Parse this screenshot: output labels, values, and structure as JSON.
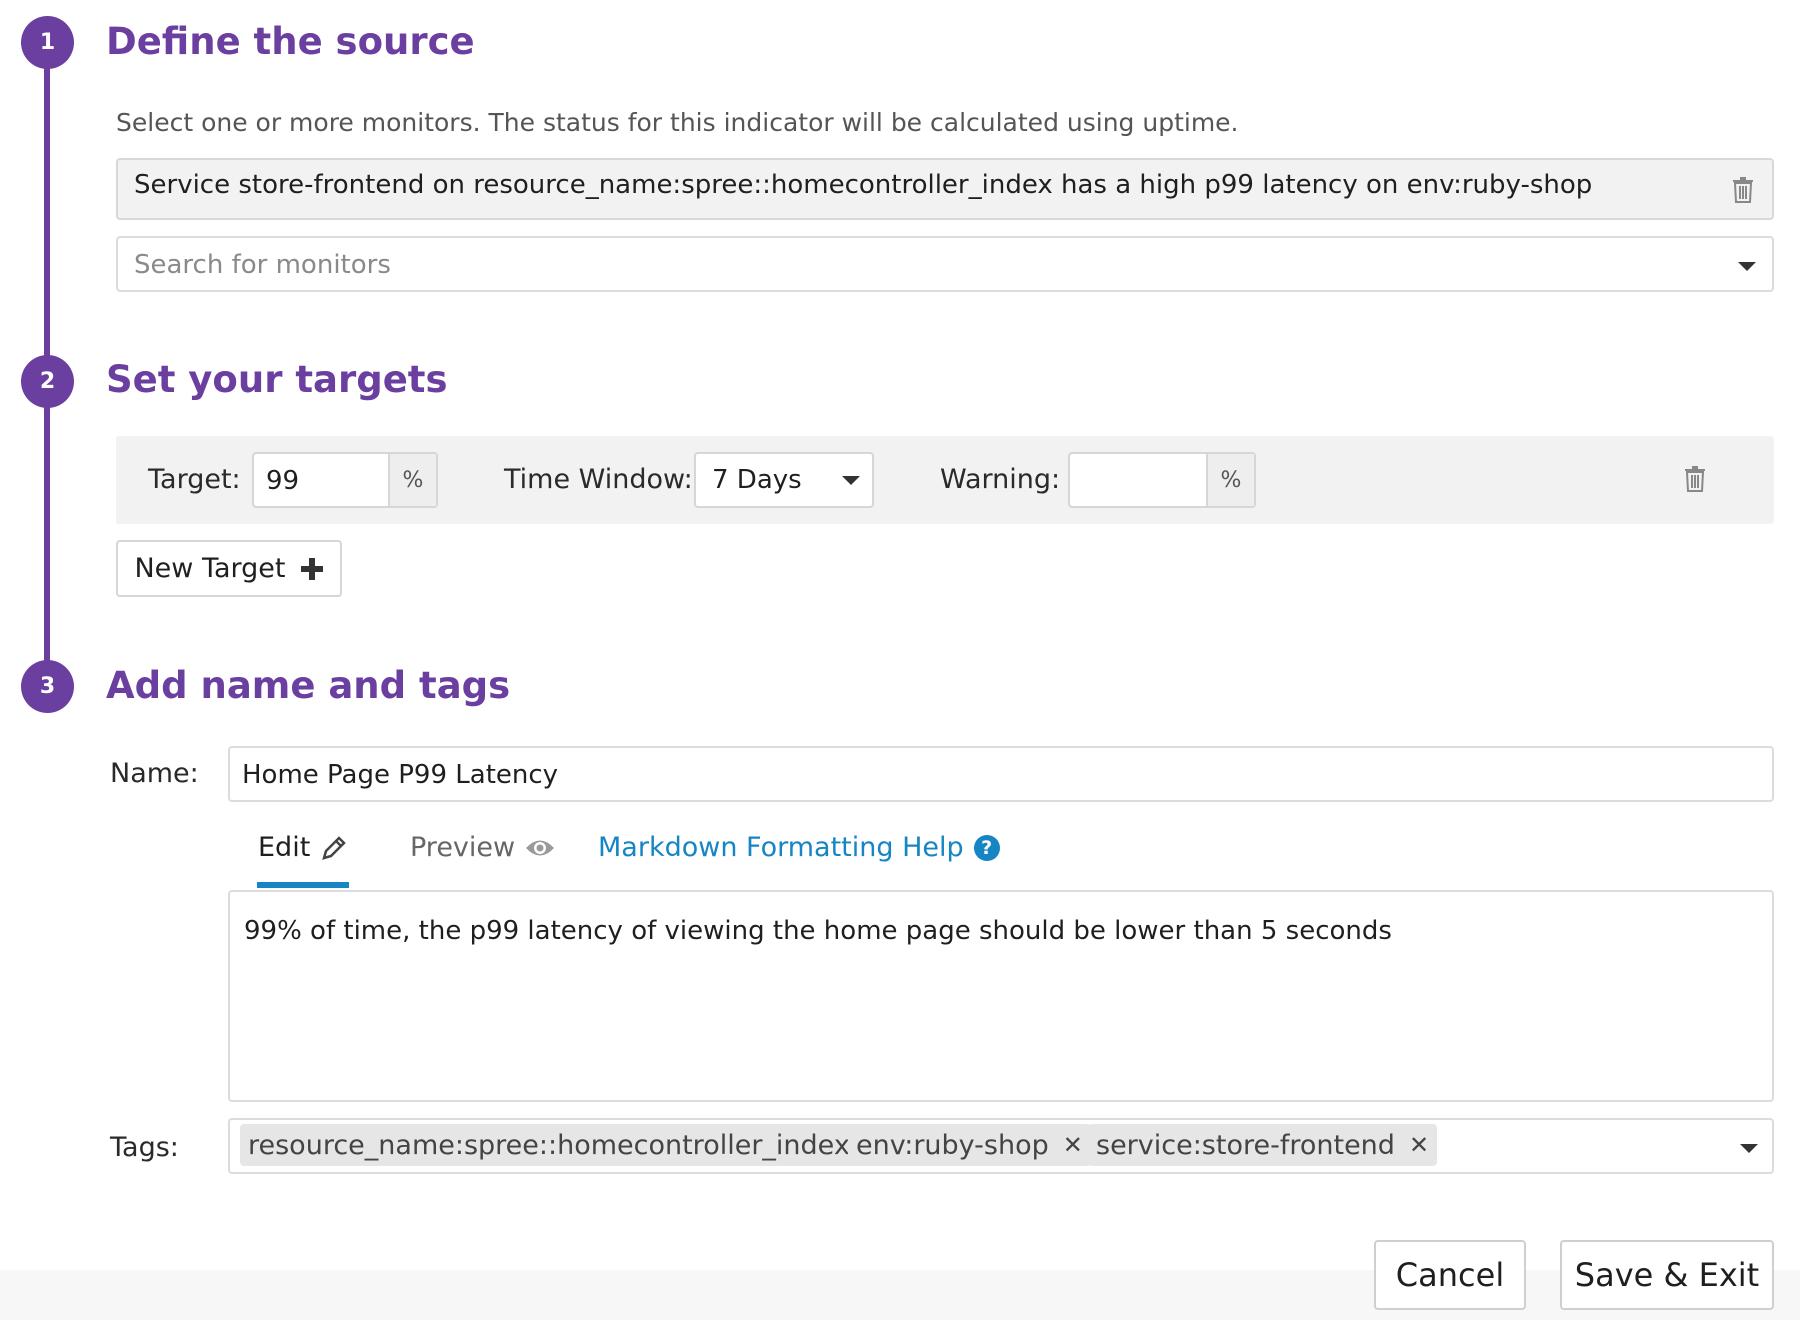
{
  "steps": [
    {
      "number": "1",
      "title": "Define the source"
    },
    {
      "number": "2",
      "title": "Set your targets"
    },
    {
      "number": "3",
      "title": "Add name and tags"
    }
  ],
  "source": {
    "description": "Select one or more monitors. The status for this indicator will be calculated using uptime.",
    "selected_monitor": "Service store-frontend on resource_name:spree::homecontroller_index has a high p99 latency on env:ruby-shop",
    "search_placeholder": "Search for monitors"
  },
  "targets": {
    "target_label": "Target:",
    "target_value": "99",
    "target_unit": "%",
    "time_window_label": "Time Window:",
    "time_window_value": "7 Days",
    "warning_label": "Warning:",
    "warning_value": "",
    "warning_unit": "%",
    "new_target_label": "New Target"
  },
  "name_tags": {
    "name_label": "Name:",
    "name_value": "Home Page P99 Latency",
    "tabs": {
      "edit": "Edit",
      "preview": "Preview",
      "help": "Markdown Formatting Help"
    },
    "description_value": "99% of time, the p99 latency of viewing the home page should be lower than 5 seconds",
    "tags_label": "Tags:",
    "tags": [
      "resource_name:spree::homecontroller_index",
      "env:ruby-shop",
      "service:store-frontend"
    ]
  },
  "footer": {
    "cancel_label": "Cancel",
    "save_label": "Save & Exit"
  },
  "icons": {
    "trash": "trash-icon",
    "caret": "chevron-down-icon",
    "plus": "plus-icon",
    "pencil": "pencil-icon",
    "eye": "eye-icon",
    "help": "question-circle-icon",
    "close": "close-icon"
  },
  "colors": {
    "accent_purple": "#6b3fa0",
    "link_blue": "#1585c4"
  }
}
